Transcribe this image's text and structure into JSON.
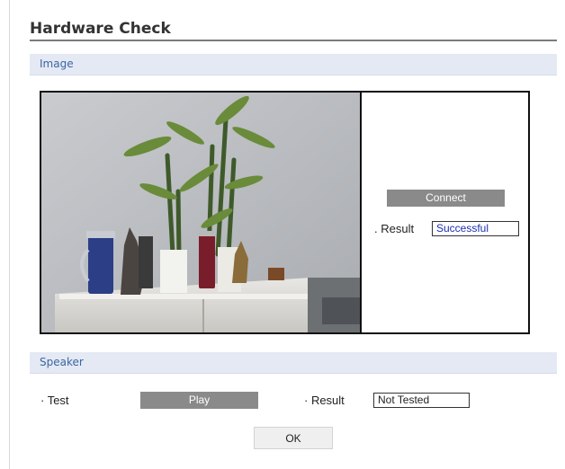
{
  "page": {
    "title": "Hardware Check"
  },
  "image_section": {
    "header": "Image",
    "connect_label": "Connect",
    "result_label": ". Result",
    "result_value": "Successful"
  },
  "speaker_section": {
    "header": "Speaker",
    "test_label": "· Test",
    "play_label": "Play",
    "result_label": "· Result",
    "result_value": "Not Tested"
  },
  "footer": {
    "ok_label": "OK"
  },
  "colors": {
    "section_header_bg": "#e4e9f4",
    "section_header_text": "#3a66a3",
    "button_gray": "#8a8a8a",
    "success_text": "#1a2fb0"
  },
  "icons": {
    "camera_preview": "camera-feed-image"
  }
}
